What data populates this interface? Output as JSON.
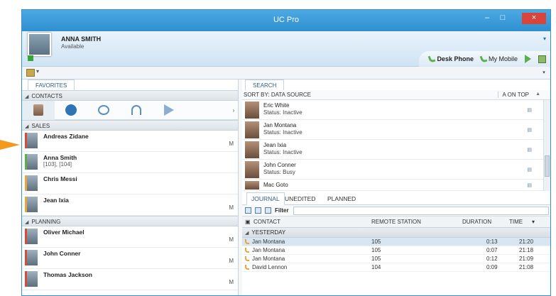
{
  "window": {
    "title": "UC Pro",
    "minimize_label": "–",
    "maximize_label": "□",
    "close_label": "×"
  },
  "colors": {
    "titlebar": "#3a9bd9",
    "close": "#d9453a",
    "accent_green": "#5cb04a",
    "arrow": "#f39a1e"
  },
  "user": {
    "name": "ANNA SMITH",
    "status": "Available"
  },
  "header": {
    "menu_caret": "▾",
    "devices": [
      {
        "label": "Desk Phone",
        "icon": "phone-icon"
      },
      {
        "label": "My Mobile",
        "icon": "phone-icon"
      }
    ]
  },
  "toolbar": {
    "caret": "▾",
    "dropdown": "▾"
  },
  "favorites": {
    "tab": "FAVORITES",
    "groups": [
      {
        "label": "CONTACTS"
      },
      {
        "label": "SALES",
        "contacts": [
          {
            "name": "Andreas Zidane",
            "sub": "",
            "mark": "M"
          },
          {
            "name": "Anna Smith",
            "sub": "[103], [104]",
            "mark": ""
          },
          {
            "name": "Chris Messi",
            "sub": "",
            "mark": ""
          },
          {
            "name": "Jean Ixia",
            "sub": "",
            "mark": "M"
          }
        ]
      },
      {
        "label": "PLANNING",
        "contacts": [
          {
            "name": "Oliver Michael",
            "sub": "",
            "mark": "M"
          },
          {
            "name": "John Conner",
            "sub": "",
            "mark": "M"
          },
          {
            "name": "Thomas Jackson",
            "sub": "",
            "mark": "M"
          }
        ]
      }
    ],
    "action_icons": [
      "user-icon",
      "phone-user-icon",
      "chat-icon",
      "headset-icon",
      "play-icon"
    ],
    "more": "›"
  },
  "search": {
    "tab": "SEARCH",
    "sort_by": "SORT BY: DATA SOURCE",
    "order": "A ON TOP",
    "order_caret": "▲",
    "results": [
      {
        "name": "Eric White",
        "status": "Status: Inactive"
      },
      {
        "name": "Jan Montana",
        "status": "Status: Inactive"
      },
      {
        "name": "Jean Ixia",
        "status": "Status: Inactive"
      },
      {
        "name": "John Conner",
        "status": "Status: Busy"
      },
      {
        "name": "Mac Goto",
        "status": ""
      }
    ]
  },
  "journal": {
    "tabs": [
      "JOURNAL",
      "UNEDITED",
      "PLANNED"
    ],
    "filter_label": "Filter",
    "filter_value": "",
    "columns": [
      "CONTACT",
      "REMOTE STATION",
      "DURATION",
      "TIME"
    ],
    "group": "YESTERDAY",
    "rows": [
      {
        "contact": "Jan Montana",
        "station": "105",
        "duration": "0:13",
        "time": "21:20",
        "selected": true
      },
      {
        "contact": "Jan Montana",
        "station": "105",
        "duration": "0:07",
        "time": "21:18",
        "selected": false
      },
      {
        "contact": "Jan Montana",
        "station": "105",
        "duration": "0:12",
        "time": "21:09",
        "selected": false
      },
      {
        "contact": "David Lennon",
        "station": "104",
        "duration": "0:09",
        "time": "21:08",
        "selected": false
      }
    ]
  }
}
